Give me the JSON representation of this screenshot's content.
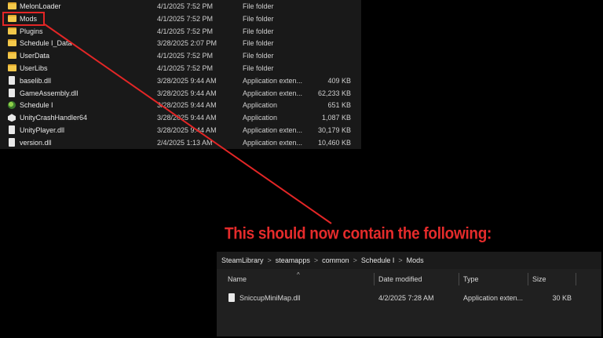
{
  "listing": {
    "rows": [
      {
        "icon": "folder-icon",
        "name": "MelonLoader",
        "date": "4/1/2025 7:52 PM",
        "type": "File folder",
        "size": ""
      },
      {
        "icon": "folder-icon",
        "name": "Mods",
        "date": "4/1/2025 7:52 PM",
        "type": "File folder",
        "size": ""
      },
      {
        "icon": "folder-icon",
        "name": "Plugins",
        "date": "4/1/2025 7:52 PM",
        "type": "File folder",
        "size": ""
      },
      {
        "icon": "folder-icon",
        "name": "Schedule I_Data",
        "date": "3/28/2025 2:07 PM",
        "type": "File folder",
        "size": ""
      },
      {
        "icon": "folder-icon",
        "name": "UserData",
        "date": "4/1/2025 7:52 PM",
        "type": "File folder",
        "size": ""
      },
      {
        "icon": "folder-icon",
        "name": "UserLibs",
        "date": "4/1/2025 7:52 PM",
        "type": "File folder",
        "size": ""
      },
      {
        "icon": "dll-file-icon",
        "name": "baselib.dll",
        "date": "3/28/2025 9:44 AM",
        "type": "Application exten...",
        "size": "409 KB"
      },
      {
        "icon": "dll-file-icon",
        "name": "GameAssembly.dll",
        "date": "3/28/2025 9:44 AM",
        "type": "Application exten...",
        "size": "62,233 KB"
      },
      {
        "icon": "app-icon",
        "name": "Schedule I",
        "date": "3/28/2025 9:44 AM",
        "type": "Application",
        "size": "651 KB"
      },
      {
        "icon": "unity-icon",
        "name": "UnityCrashHandler64",
        "date": "3/28/2025 9:44 AM",
        "type": "Application",
        "size": "1,087 KB"
      },
      {
        "icon": "dll-file-icon",
        "name": "UnityPlayer.dll",
        "date": "3/28/2025 9:44 AM",
        "type": "Application exten...",
        "size": "30,179 KB"
      },
      {
        "icon": "dll-file-icon",
        "name": "version.dll",
        "date": "2/4/2025 1:13 AM",
        "type": "Application exten...",
        "size": "10,460 KB"
      }
    ]
  },
  "callout": {
    "text": "This should now contain the following:",
    "color": "#e52b2b"
  },
  "panel": {
    "breadcrumbs": [
      "SteamLibrary",
      "steamapps",
      "common",
      "Schedule I",
      "Mods"
    ],
    "separator": ">",
    "columns": {
      "name": "Name",
      "date": "Date modified",
      "type": "Type",
      "size": "Size",
      "sort_caret": "^"
    },
    "file": {
      "name": "SniccupMiniMap.dll",
      "date": "4/2/2025 7:28 AM",
      "type": "Application exten...",
      "size": "30 KB"
    }
  }
}
